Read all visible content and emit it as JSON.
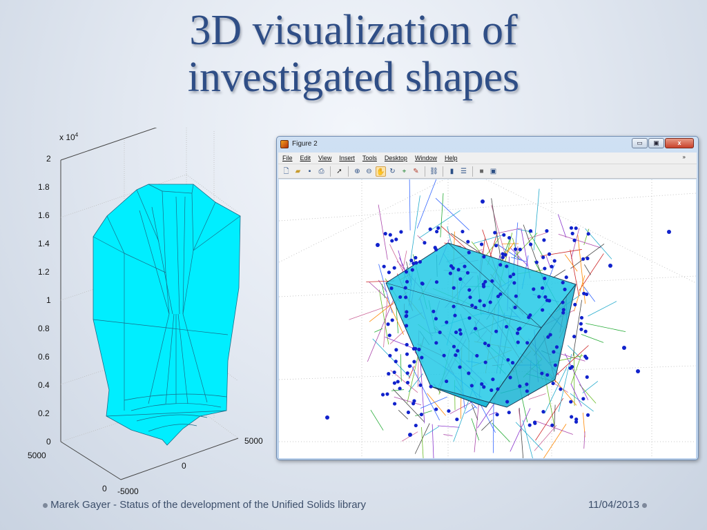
{
  "slide": {
    "title_line1": "3D visualization of",
    "title_line2": "investigated shapes",
    "footer_left": "Marek Gayer - Status of the development of the Unified Solids library",
    "footer_right": "11/04/2013"
  },
  "plot": {
    "z_exponent": "x 10",
    "z_exponent_power": "4",
    "z_ticks": [
      "2",
      "1.8",
      "1.6",
      "1.4",
      "1.2",
      "1",
      "0.8",
      "0.6",
      "0.4",
      "0.2",
      "0"
    ],
    "y_ticks": [
      "5000",
      "0"
    ],
    "x_ticks": [
      "-5000",
      "0",
      "5000"
    ],
    "shape_color": "#00eeff",
    "edge_color": "#1a6b88"
  },
  "window": {
    "title": "Figure 2",
    "controls": {
      "minimize": "▭",
      "maximize": "▣",
      "close": "x"
    },
    "menu": [
      "File",
      "Edit",
      "View",
      "Insert",
      "Tools",
      "Desktop",
      "Window",
      "Help"
    ],
    "menu_overflow": "»",
    "toolbar_icons": [
      "new-figure-icon",
      "open-icon",
      "save-icon",
      "print-icon",
      "pointer-icon",
      "zoom-in-icon",
      "zoom-out-icon",
      "pan-icon",
      "rotate-icon",
      "data-cursor-icon",
      "brush-icon",
      "link-icon",
      "colorbar-icon",
      "legend-icon",
      "hide-tools-icon",
      "show-tools-icon"
    ],
    "point_color": "#1122cc",
    "solid_color": "#22c9e6"
  }
}
